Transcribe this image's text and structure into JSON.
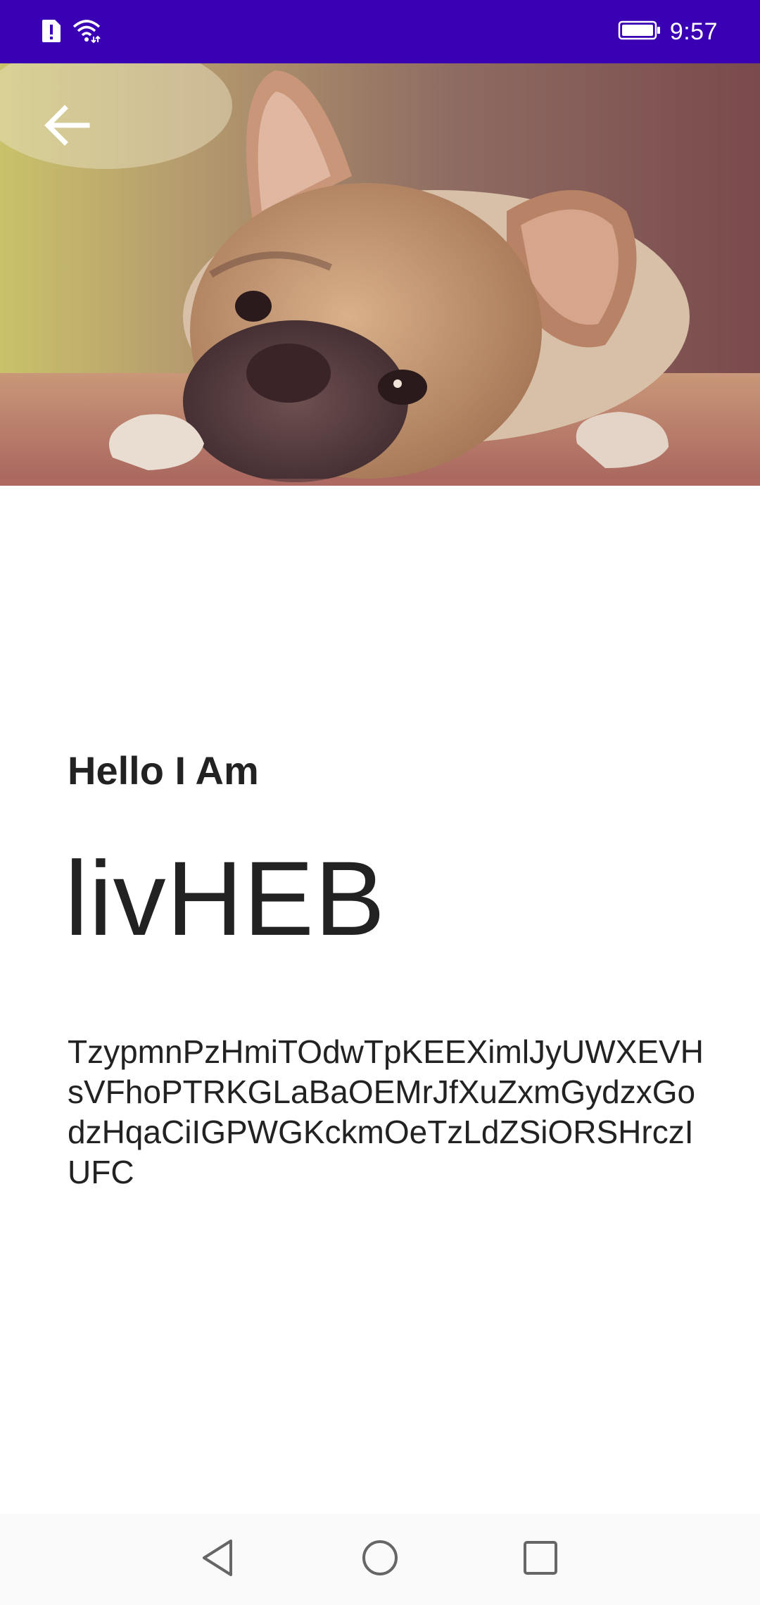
{
  "status_bar": {
    "time": "9:57",
    "icons": [
      "sim-alert-icon",
      "wifi-icon",
      "battery-icon"
    ],
    "background_color": "#3a00b3"
  },
  "hero": {
    "image": "dog-photo",
    "back_icon": "arrow-left-icon"
  },
  "profile": {
    "greeting": "Hello I Am",
    "name": "livHEB",
    "description": "TzypmnPzHmiTOdwTpKEEXimlJyUWXEVHsVFhoPTRKGLaBaOEMrJfXuZxmGydzxGodzHqaCiIGPWGKckmOeTzLdZSiORSHrczIUFC"
  },
  "nav_bar": {
    "icons": [
      "back-triangle-icon",
      "home-circle-icon",
      "recents-square-icon"
    ]
  }
}
